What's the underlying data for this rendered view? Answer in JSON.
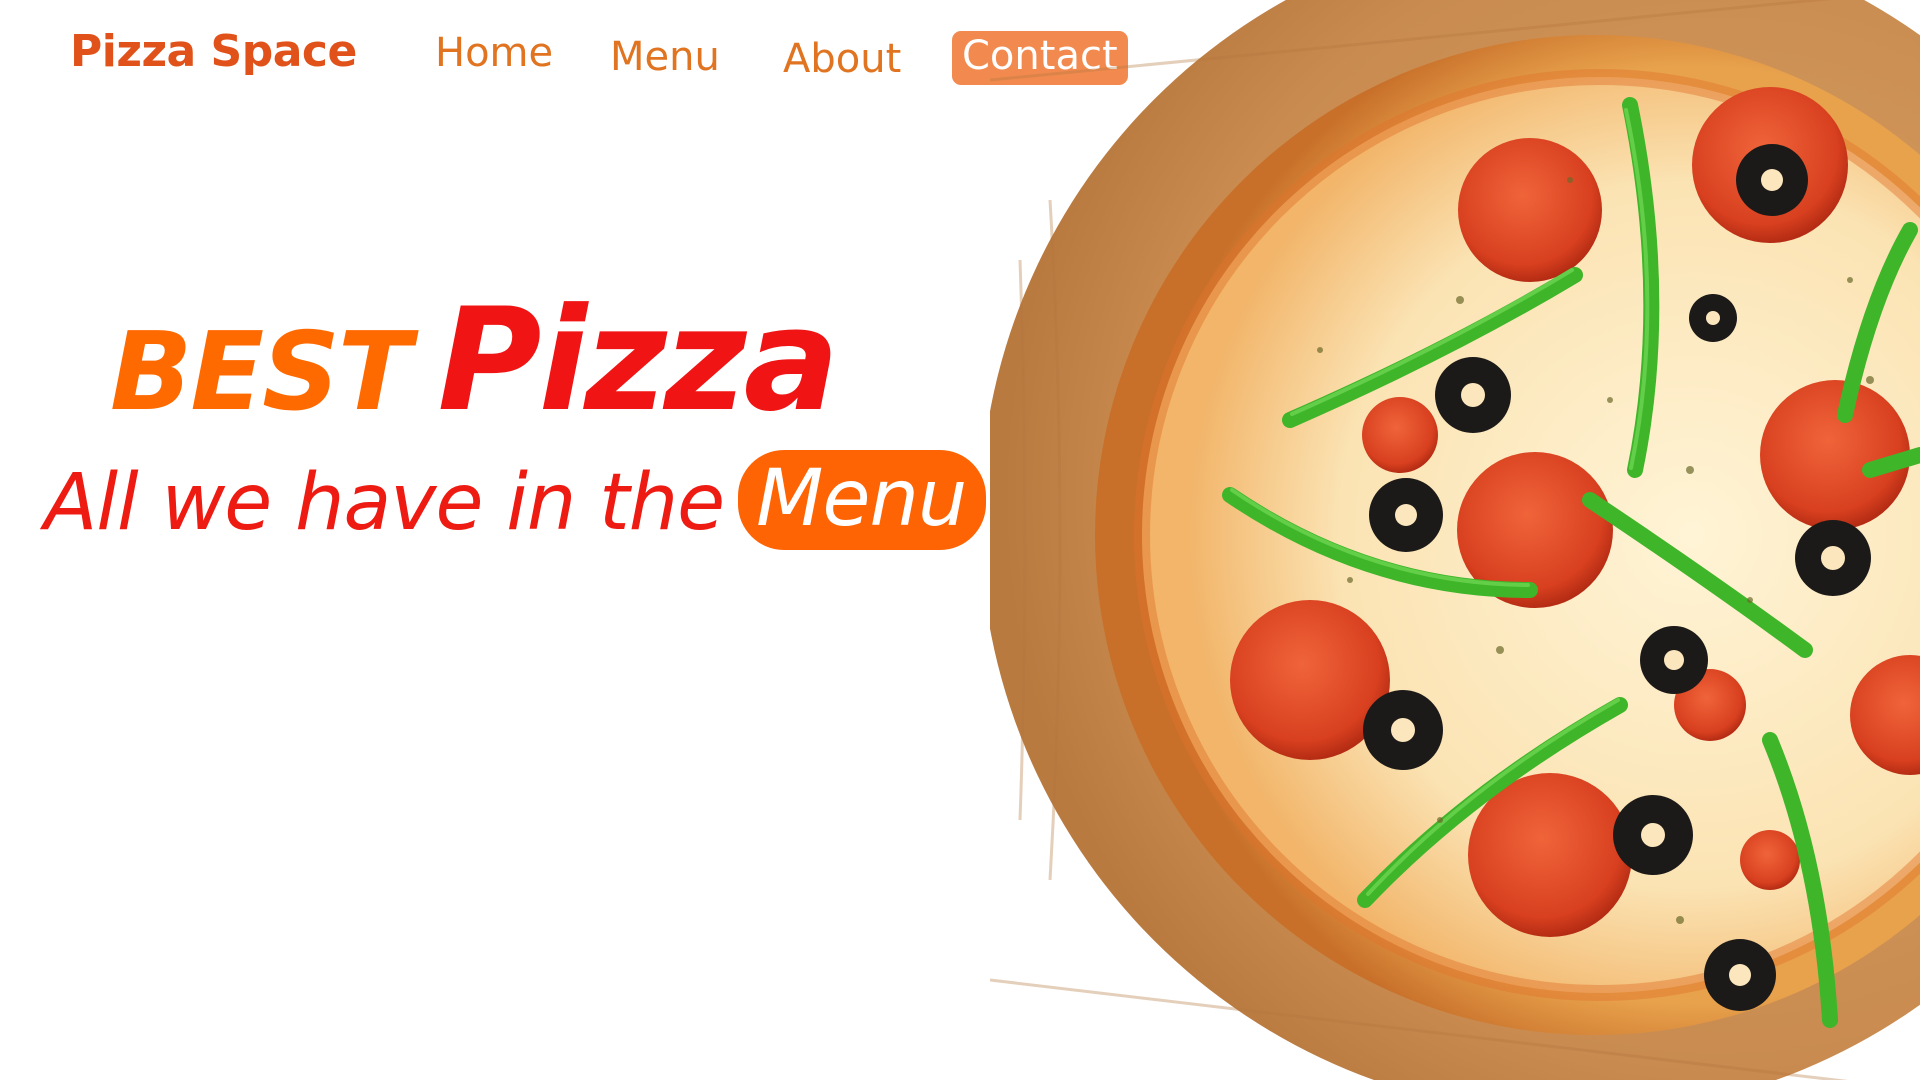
{
  "brand": {
    "name": "Pizza Space"
  },
  "nav": {
    "home": "Home",
    "menu": "Menu",
    "about": "About",
    "contact": "Contact"
  },
  "hero": {
    "word1": "BEST",
    "word2": "Pizza",
    "tagline": "All we have in the",
    "menu_button": "Menu"
  },
  "colors": {
    "brand_orange": "#e0521a",
    "nav_orange": "#e07420",
    "contact_bg": "#f28a4f",
    "accent_orange": "#ff6404",
    "accent_red": "#ee1b12"
  },
  "images": {
    "hero": "pepperoni-pizza-on-wooden-board"
  }
}
